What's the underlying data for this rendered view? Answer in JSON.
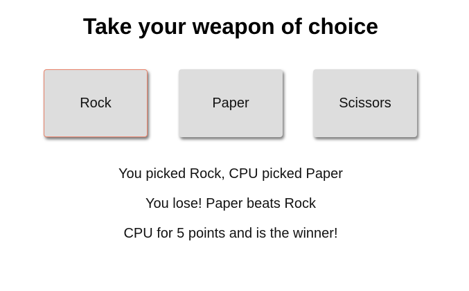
{
  "heading": "Take your weapon of choice",
  "choices": [
    {
      "label": "Rock",
      "selected": true
    },
    {
      "label": "Paper",
      "selected": false
    },
    {
      "label": "Scissors",
      "selected": false
    }
  ],
  "results": {
    "picks": "You picked Rock, CPU picked Paper",
    "round_outcome": "You lose! Paper beats Rock",
    "game_outcome": "CPU for 5 points and is the winner!"
  },
  "colors": {
    "button_background": "#dddddd",
    "selected_border": "#e8826a",
    "text": "#111111"
  }
}
